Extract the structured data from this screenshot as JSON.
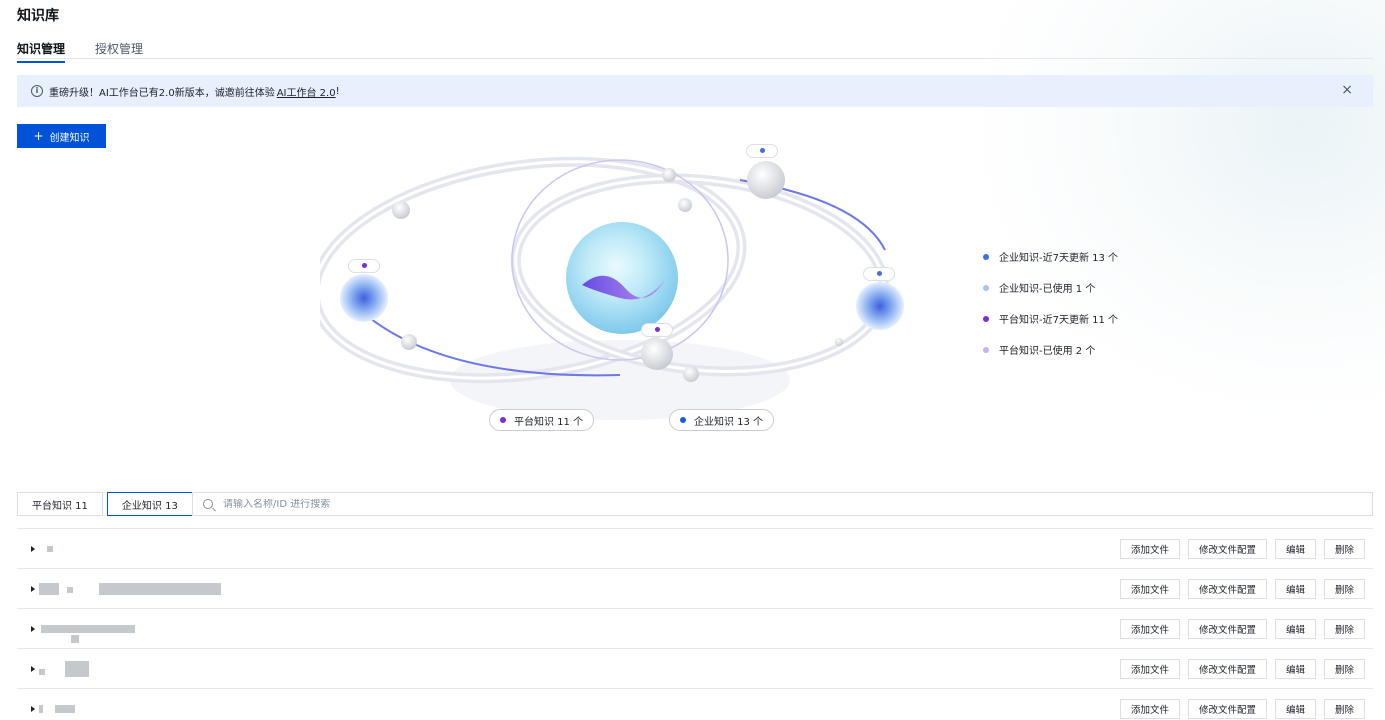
{
  "page": {
    "title": "知识库"
  },
  "top_tabs": [
    {
      "label": "知识管理",
      "active": true
    },
    {
      "label": "授权管理",
      "active": false
    }
  ],
  "banner": {
    "text": "重磅升级！AI工作台已有2.0新版本，诚邀前往体验",
    "link": "AI工作台 2.0",
    "suffix": "!",
    "info_icon": "i",
    "close_icon": "×"
  },
  "create_button": {
    "icon": "+",
    "label": "创建知识"
  },
  "visual": {
    "pills": [
      {
        "label": "平台知识 11 个",
        "color": "#7a2ed6"
      },
      {
        "label": "企业知识 13 个",
        "color": "#1e5ae0"
      }
    ]
  },
  "legend": [
    {
      "label": "企业知识-近7天更新 13 个",
      "color": "#3e6de8"
    },
    {
      "label": "企业知识-已使用 1 个",
      "color": "#a9c2f5"
    },
    {
      "label": "平台知识-近7天更新 11 个",
      "color": "#7a2ed6"
    },
    {
      "label": "平台知识-已使用 2 个",
      "color": "#c6b0f0"
    }
  ],
  "list_tabs": [
    {
      "label": "平台知识 11",
      "active": false
    },
    {
      "label": "企业知识 13",
      "active": true
    }
  ],
  "search": {
    "placeholder": "请输入名称/ID 进行搜索",
    "value": ""
  },
  "row_actions": {
    "add_file": "添加文件",
    "edit_config": "修改文件配置",
    "edit": "编辑",
    "delete": "删除"
  }
}
